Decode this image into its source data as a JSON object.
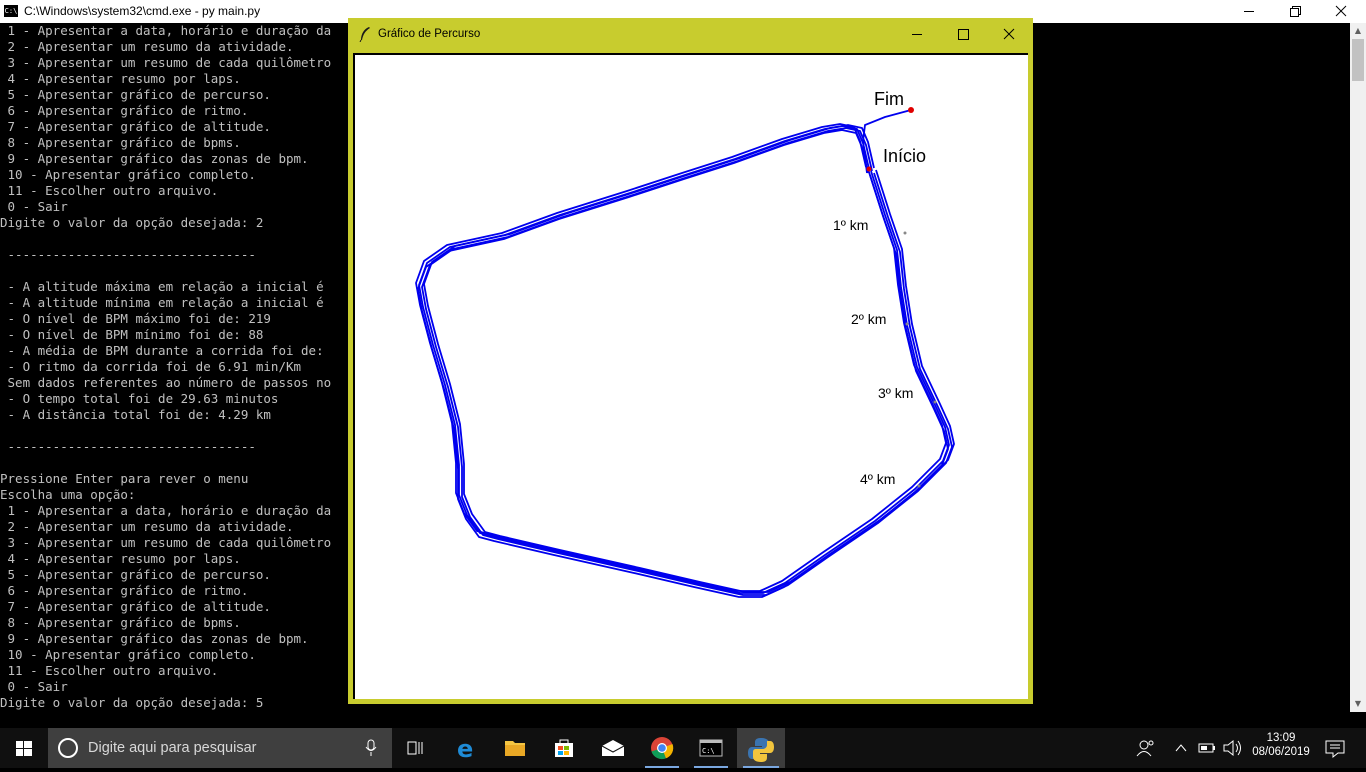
{
  "cmd": {
    "title": "C:\\Windows\\system32\\cmd.exe - py  main.py",
    "lines": [
      " 1 - Apresentar a data, horário e duração da",
      " 2 - Apresentar um resumo da atividade.",
      " 3 - Apresentar um resumo de cada quilômetro",
      " 4 - Apresentar resumo por laps.",
      " 5 - Apresentar gráfico de percurso.",
      " 6 - Apresentar gráfico de ritmo.",
      " 7 - Apresentar gráfico de altitude.",
      " 8 - Apresentar gráfico de bpms.",
      " 9 - Apresentar gráfico das zonas de bpm.",
      " 10 - Apresentar gráfico completo.",
      " 11 - Escolher outro arquivo.",
      " 0 - Sair",
      "Digite o valor da opção desejada: 2",
      "",
      " ---------------------------------",
      "",
      " - A altitude máxima em relação a inicial é",
      " - A altitude mínima em relação a inicial é",
      " - O nível de BPM máximo foi de: 219",
      " - O nível de BPM mínimo foi de: 88",
      " - A média de BPM durante a corrida foi de:",
      " - O ritmo da corrida foi de 6.91 min/Km",
      " Sem dados referentes ao número de passos no",
      " - O tempo total foi de 29.63 minutos",
      " - A distância total foi de: 4.29 km",
      "",
      " ---------------------------------",
      "",
      "Pressione Enter para rever o menu",
      "Escolha uma opção:",
      " 1 - Apresentar a data, horário e duração da",
      " 2 - Apresentar um resumo da atividade.",
      " 3 - Apresentar um resumo de cada quilômetro",
      " 4 - Apresentar resumo por laps.",
      " 5 - Apresentar gráfico de percurso.",
      " 6 - Apresentar gráfico de ritmo.",
      " 7 - Apresentar gráfico de altitude.",
      " 8 - Apresentar gráfico de bpms.",
      " 9 - Apresentar gráfico das zonas de bpm.",
      " 10 - Apresentar gráfico completo.",
      " 11 - Escolher outro arquivo.",
      " 0 - Sair",
      "Digite o valor da opção desejada: 5"
    ],
    "minimize_icon": "minimize-icon",
    "restore_icon": "restore-icon",
    "close_icon": "close-icon"
  },
  "plot_window": {
    "title": "Gráfico de Percurso",
    "titlebar_color": "#c8cc2e",
    "route_color": "#0000ee",
    "marker_color": "#e00000",
    "labels": {
      "end": "Fim",
      "start": "Início",
      "km1": "1º km",
      "km2": "2º km",
      "km3": "3º km",
      "km4": "4º km"
    }
  },
  "taskbar": {
    "search_placeholder": "Digite aqui para pesquisar",
    "apps": [
      "task-view-icon",
      "edge-icon",
      "file-explorer-icon",
      "store-icon",
      "mail-icon",
      "chrome-icon",
      "cmd-icon",
      "python-icon"
    ],
    "time": "13:09",
    "date": "08/06/2019"
  }
}
